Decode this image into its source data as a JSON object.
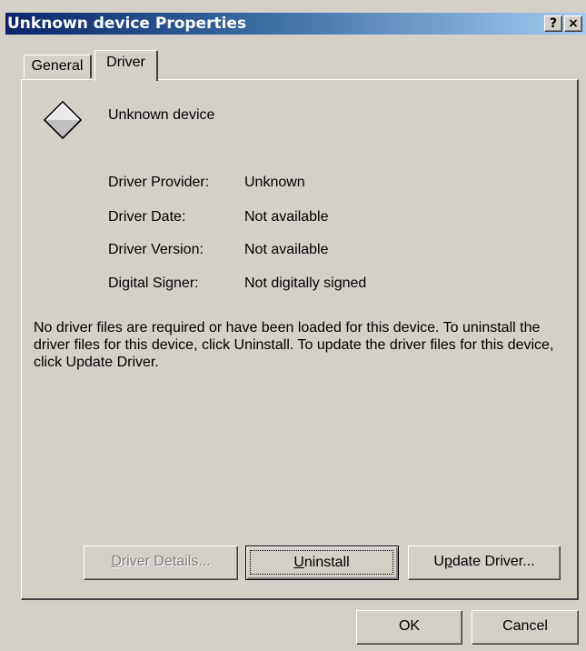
{
  "window": {
    "title": "Unknown device Properties",
    "help_label": "?",
    "close_label": "×"
  },
  "tabs": [
    {
      "label": "General",
      "active": false
    },
    {
      "label": "Driver",
      "active": true
    }
  ],
  "device": {
    "name": "Unknown device",
    "icon": "unknown-device-diamond-icon"
  },
  "driver_info": [
    {
      "label": "Driver Provider:",
      "value": "Unknown"
    },
    {
      "label": "Driver Date:",
      "value": "Not available"
    },
    {
      "label": "Driver Version:",
      "value": "Not available"
    },
    {
      "label": "Digital Signer:",
      "value": "Not digitally signed"
    }
  ],
  "message": "No driver files are required or have been loaded for this device. To uninstall the driver files for this device, click Uninstall. To update the driver files for this device, click Update Driver.",
  "buttons": {
    "driver_details": {
      "label": "Driver Details...",
      "mnemonic": "D",
      "rest": "river Details...",
      "enabled": false
    },
    "uninstall": {
      "label": "Uninstall",
      "mnemonic": "U",
      "rest": "ninstall",
      "enabled": true,
      "focused": true
    },
    "update_driver": {
      "label": "Update Driver...",
      "pre": "U",
      "mnemonic": "p",
      "rest": "date Driver...",
      "enabled": true
    },
    "ok": {
      "label": "OK"
    },
    "cancel": {
      "label": "Cancel"
    }
  }
}
